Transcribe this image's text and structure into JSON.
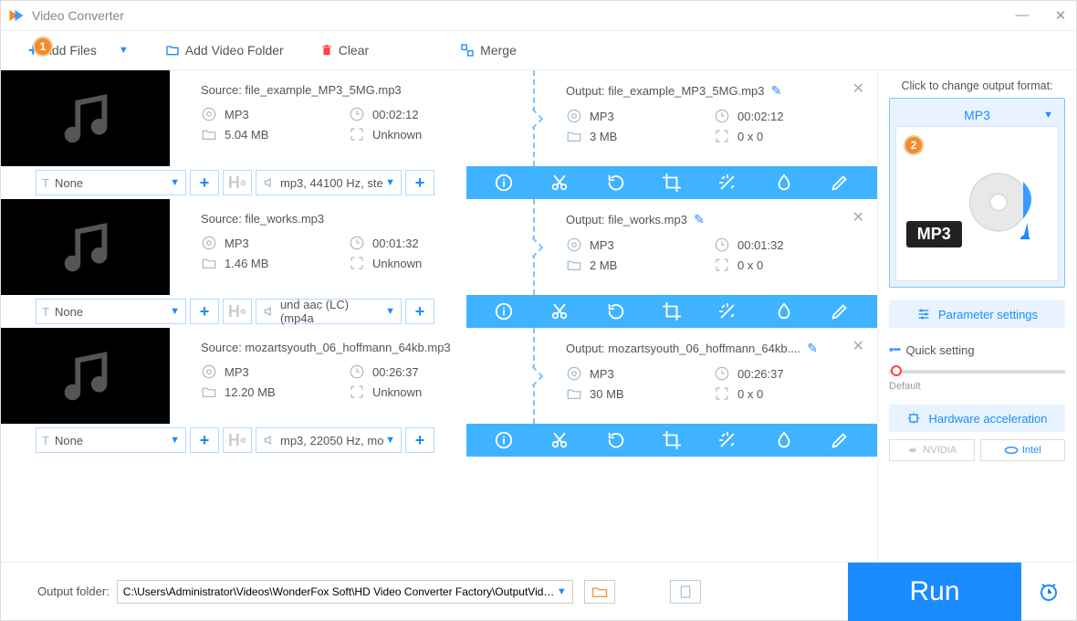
{
  "window": {
    "title": "Video Converter"
  },
  "toolbar": {
    "add_files": "Add Files",
    "add_folder": "Add Video Folder",
    "clear": "Clear",
    "merge": "Merge"
  },
  "badges": [
    "1",
    "2"
  ],
  "files": [
    {
      "source_label": "Source: file_example_MP3_5MG.mp3",
      "output_label": "Output: file_example_MP3_5MG.mp3",
      "src_fmt": "MP3",
      "src_dur": "00:02:12",
      "src_size": "5.04 MB",
      "src_res": "Unknown",
      "out_fmt": "MP3",
      "out_dur": "00:02:12",
      "out_size": "3 MB",
      "out_res": "0 x 0",
      "subtitle": "None",
      "audio": "mp3, 44100 Hz, ste"
    },
    {
      "source_label": "Source: file_works.mp3",
      "output_label": "Output: file_works.mp3",
      "src_fmt": "MP3",
      "src_dur": "00:01:32",
      "src_size": "1.46 MB",
      "src_res": "Unknown",
      "out_fmt": "MP3",
      "out_dur": "00:01:32",
      "out_size": "2 MB",
      "out_res": "0 x 0",
      "subtitle": "None",
      "audio": "und aac (LC) (mp4a"
    },
    {
      "source_label": "Source: mozartsyouth_06_hoffmann_64kb.mp3",
      "output_label": "Output: mozartsyouth_06_hoffmann_64kb....",
      "src_fmt": "MP3",
      "src_dur": "00:26:37",
      "src_size": "12.20 MB",
      "src_res": "Unknown",
      "out_fmt": "MP3",
      "out_dur": "00:26:37",
      "out_size": "30 MB",
      "out_res": "0 x 0",
      "subtitle": "None",
      "audio": "mp3, 22050 Hz, mo"
    }
  ],
  "side": {
    "title": "Click to change output format:",
    "format": "MP3",
    "format_art": "MP3",
    "param_btn": "Parameter settings",
    "quick": "Quick setting",
    "slider_label": "Default",
    "hw_btn": "Hardware acceleration",
    "nvidia": "NVIDIA",
    "intel": "Intel"
  },
  "bottom": {
    "label": "Output folder:",
    "path": "C:\\Users\\Administrator\\Videos\\WonderFox Soft\\HD Video Converter Factory\\OutputVideo\\",
    "run": "Run"
  }
}
